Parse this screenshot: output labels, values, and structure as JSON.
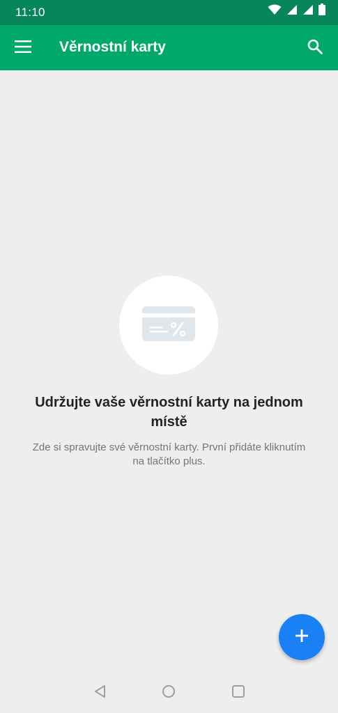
{
  "status_bar": {
    "time": "11:10",
    "icons": [
      "wifi-icon",
      "signal-icon",
      "signal-roaming-icon",
      "battery-icon"
    ]
  },
  "app_bar": {
    "title": "Věrnostní karty",
    "menu_icon": "menu-icon",
    "search_icon": "search-icon"
  },
  "empty_state": {
    "illustration_icon": "loyalty-card-discount-icon",
    "title": "Udržujte vaše věrnostní karty na jednom místě",
    "subtitle": "Zde si spravujte své věrnostní karty. První přidáte kliknutím na tlačítko plus."
  },
  "fab": {
    "icon": "plus-icon"
  },
  "nav_bar": {
    "buttons": [
      "back-icon",
      "home-icon",
      "recents-icon"
    ]
  },
  "colors": {
    "status_bar": "#06865a",
    "app_bar": "#00a86b",
    "background": "#eeeeee",
    "fab": "#1a80f5",
    "illustration": "#dfe6ec"
  }
}
